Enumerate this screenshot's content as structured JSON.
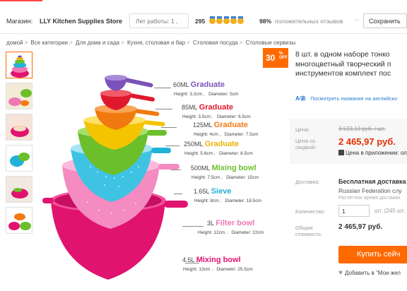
{
  "store": {
    "label": "Магазин:",
    "name": "LLY Kitchen Supplies Store",
    "years": "Лет работы: 1 ,",
    "feedback_count": "295",
    "positive_pct": "98%",
    "positive_label": "положительных отзывов",
    "save_label": "Сохранить"
  },
  "breadcrumb": [
    "домой",
    "Все категории",
    "Для дома и сада",
    "Кухня, столовая и бар",
    "Столовая посуда",
    "Столовые сервизы"
  ],
  "image": {
    "discount": "30",
    "discount_unit": "%",
    "discount_off": "OFF",
    "items": [
      {
        "vol": "60ML",
        "name": "Graduate",
        "spec_height": "Height: 3.2cm",
        "spec_diam": "Diameter: 5cm",
        "color": "#7b52b9"
      },
      {
        "vol": "85ML",
        "name": "Graduate",
        "spec_height": "Height: 3.5cm",
        "spec_diam": "Diameter: 6.5cm",
        "color": "#e0182d"
      },
      {
        "vol": "125ML",
        "name": "Graduate",
        "spec_height": "Height: 4cm",
        "spec_diam": "Diameter: 7.5cm",
        "color": "#f07a10"
      },
      {
        "vol": "250ML",
        "name": "Graduate",
        "spec_height": "Height: 5.6cm",
        "spec_diam": "Diameter: 8.5cm",
        "color": "#e9b400"
      },
      {
        "vol": "500ML",
        "name": "Mixing bowl",
        "spec_height": "Height: 7.5cm",
        "spec_diam": "Diameter: 15cm",
        "color": "#6cbf2b"
      },
      {
        "vol": "1.65L",
        "name": "Sieve",
        "spec_height": "Height: 8cm",
        "spec_diam": "Diameter: 18.5cm",
        "color": "#23b2d8"
      },
      {
        "vol": "3L",
        "name": "Filter bowl",
        "spec_height": "Height: 12cm",
        "spec_diam": "Diameter: 22cm",
        "color": "#f077b3"
      },
      {
        "vol": "4.5L",
        "name": "Mixing bowl",
        "spec_height": "Height: 13cm",
        "spec_diam": "Diameter: 25.5cm",
        "color": "#e0136f"
      }
    ]
  },
  "product": {
    "title_lines": [
      "8 шт. в одном наборе тонко",
      "многоцветный творческий п",
      "инструментов комплект пос"
    ],
    "translate_label": "Посмотреть название на английско",
    "price_label": "Цена:",
    "old_price": "3 523,13 руб. / шт.",
    "discount_label_1": "Цена со",
    "discount_label_2": "скидкой:",
    "new_price": "2 465,97 руб.",
    "app_price": "Цена в приложении: ол",
    "shipping_label": "Доставка:",
    "shipping_title": "Бесплатная доставка",
    "shipping_dest": "Russian Federation слу",
    "shipping_time": "Расчётное время доставки",
    "qty_label": "Количество:",
    "qty_value": "1",
    "qty_note": "шт. (245 шт. в н",
    "total_label_1": "Общая",
    "total_label_2": "стоимость:",
    "total": "2 465,97 руб.",
    "buy_label": "Купить сейч",
    "wishlist_label": "Добавить в \"Мои жел"
  },
  "colors": {
    "accent": "#ff6a00",
    "price_red": "#e62e04",
    "link_blue": "#2a7bd6"
  }
}
